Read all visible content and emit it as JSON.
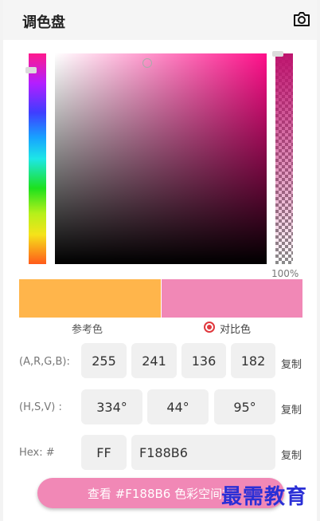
{
  "header": {
    "title": "调色盘",
    "camera_icon": "camera-icon"
  },
  "picker": {
    "hue_gradient": [
      "#ff1a8c",
      "#b41eff",
      "#3f3dff",
      "#17a3ff",
      "#1de7e7",
      "#1de11d",
      "#b6f01a",
      "#f5e31a",
      "#ff5a1a"
    ],
    "base_hue_color": "#ff0f8a",
    "alpha_percent": "100%"
  },
  "swatches": {
    "reference_color": "#ffb54b",
    "compare_color": "#f188b6",
    "reference_label": "参考色",
    "compare_label": "对比色",
    "selected": "compare"
  },
  "argb": {
    "label": "(A,R,G,B):",
    "values": [
      "255",
      "241",
      "136",
      "182"
    ],
    "copy": "复制"
  },
  "hsv": {
    "label": "(H,S,V)  :",
    "values": [
      "334°",
      "44°",
      "95°"
    ],
    "copy": "复制"
  },
  "hex": {
    "label": "Hex:   #",
    "alpha": "FF",
    "value": "F188B6",
    "copy": "复制"
  },
  "view_button": {
    "label": "查看 #F188B6 色彩空间指",
    "color": "#f188b6"
  },
  "watermark": "最需教育"
}
